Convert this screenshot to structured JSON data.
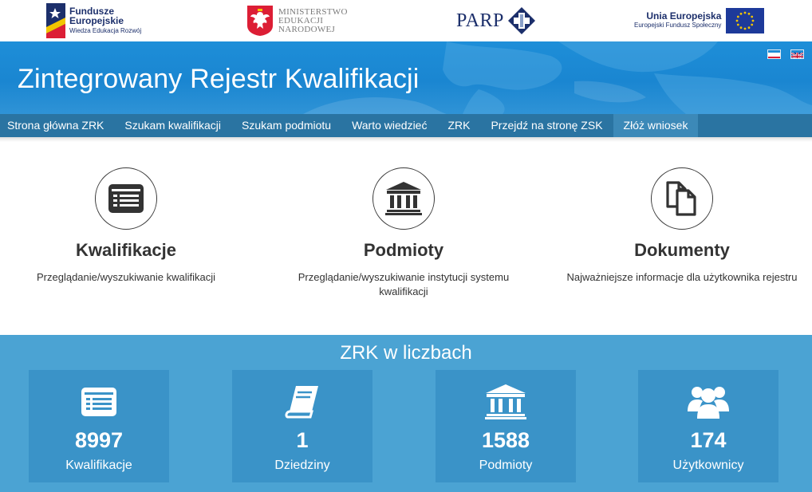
{
  "logos": {
    "fe": {
      "line1": "Fundusze",
      "line2": "Europejskie",
      "line3": "Wiedza Edukacja Rozwój"
    },
    "men": {
      "line1": "MINISTERSTWO",
      "line2": "EDUKACJI",
      "line3": "NARODOWEJ"
    },
    "parp": {
      "text": "PARP"
    },
    "ue": {
      "line1": "Unia Europejska",
      "line2": "Europejski Fundusz Społeczny"
    }
  },
  "header": {
    "title": "Zintegrowany Rejestr Kwalifikacji",
    "languages": [
      {
        "code": "pl",
        "icon": "poland-flag-icon"
      },
      {
        "code": "en",
        "icon": "uk-flag-icon"
      }
    ]
  },
  "nav": {
    "items": [
      {
        "label": "Strona główna ZRK"
      },
      {
        "label": "Szukam kwalifikacji"
      },
      {
        "label": "Szukam podmiotu"
      },
      {
        "label": "Warto wiedzieć"
      },
      {
        "label": "ZRK"
      },
      {
        "label": "Przejdź na stronę ZSK"
      },
      {
        "label": "Złóż wniosek",
        "active": true
      }
    ]
  },
  "features": [
    {
      "icon": "list-card-icon",
      "title": "Kwalifikacje",
      "desc": "Przeglądanie/wyszukiwanie kwalifikacji"
    },
    {
      "icon": "institution-icon",
      "title": "Podmioty",
      "desc": "Przeglądanie/wyszukiwanie instytucji systemu kwalifikacji"
    },
    {
      "icon": "documents-icon",
      "title": "Dokumenty",
      "desc": "Najważniejsze informacje dla użytkownika rejestru"
    }
  ],
  "stats": {
    "title": "ZRK w liczbach",
    "items": [
      {
        "icon": "list-card-icon",
        "value": "8997",
        "label": "Kwalifikacje"
      },
      {
        "icon": "book-icon",
        "value": "1",
        "label": "Dziedziny"
      },
      {
        "icon": "institution-icon",
        "value": "1588",
        "label": "Podmioty"
      },
      {
        "icon": "users-icon",
        "value": "174",
        "label": "Użytkownicy"
      }
    ]
  },
  "colors": {
    "banner": "#1e8ed8",
    "nav": "#2a74a2",
    "nav_active": "#3c89b8",
    "stats_bg": "#4ba3d3",
    "stat_box": "#3a93c8",
    "brand_navy": "#1c2f6b",
    "men_red": "#dc1e35"
  }
}
